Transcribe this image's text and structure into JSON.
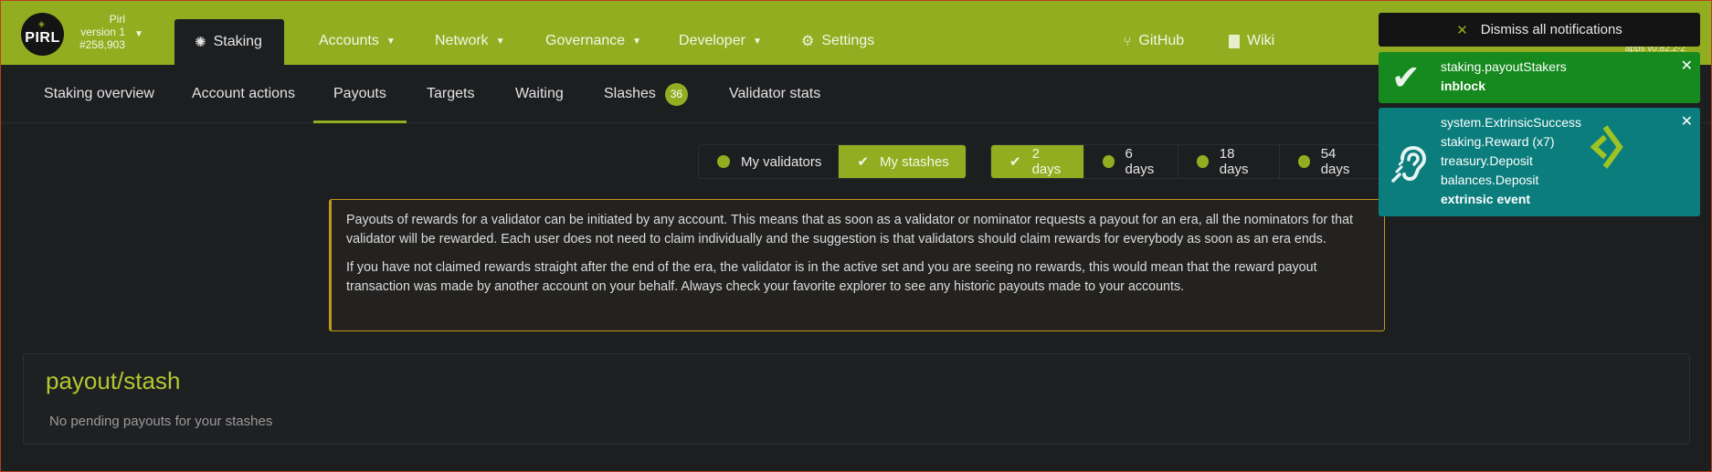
{
  "header": {
    "logo_text": "PIRL",
    "chain_name": "Pirl",
    "chain_version": "version 1",
    "block_number": "#258,903",
    "active_nav": "Staking",
    "nav": [
      {
        "label": "Accounts"
      },
      {
        "label": "Network"
      },
      {
        "label": "Governance"
      },
      {
        "label": "Developer"
      },
      {
        "label": "Settings"
      }
    ],
    "links": [
      {
        "label": "GitHub"
      },
      {
        "label": "Wiki"
      }
    ],
    "app_version": "apps v0.82.2-2"
  },
  "tabs": [
    {
      "label": "Staking overview"
    },
    {
      "label": "Account actions"
    },
    {
      "label": "Payouts",
      "active": true
    },
    {
      "label": "Targets"
    },
    {
      "label": "Waiting"
    },
    {
      "label": "Slashes",
      "badge": "36"
    },
    {
      "label": "Validator stats"
    }
  ],
  "filters": {
    "owner": [
      {
        "label": "My validators",
        "selected": false
      },
      {
        "label": "My stashes",
        "selected": true
      }
    ],
    "period": [
      {
        "label": "2 days",
        "selected": true
      },
      {
        "label": "6 days",
        "selected": false
      },
      {
        "label": "18 days",
        "selected": false
      },
      {
        "label": "54 days",
        "selected": false
      }
    ]
  },
  "info": {
    "paragraph1": "Payouts of rewards for a validator can be initiated by any account. This means that as soon as a validator or nominator requests a payout for an era, all the nominators for that validator will be rewarded. Each user does not need to claim individually and the suggestion is that validators should claim rewards for everybody as soon as an era ends.",
    "paragraph2": "If you have not claimed rewards straight after the end of the era, the validator is in the active set and you are seeing no rewards, this would mean that the reward payout transaction was made by another account on your behalf. Always check your favorite explorer to see any historic payouts made to your accounts."
  },
  "payouts_card": {
    "title": "payout/stash",
    "empty_message": "No pending payouts for your stashes"
  },
  "notifications": {
    "dismiss_label": "Dismiss all notifications",
    "success": {
      "method": "staking.payoutStakers",
      "status": "inblock"
    },
    "event": {
      "lines": [
        "system.ExtrinsicSuccess",
        "staking.Reward (x7)",
        "treasury.Deposit",
        "balances.Deposit"
      ],
      "status": "extrinsic event"
    }
  },
  "colors": {
    "accent": "#93ad21",
    "background": "#1d1e20",
    "warning_border": "#c19a17",
    "notif_success": "#168a1e",
    "notif_event": "#0b7d7c"
  }
}
